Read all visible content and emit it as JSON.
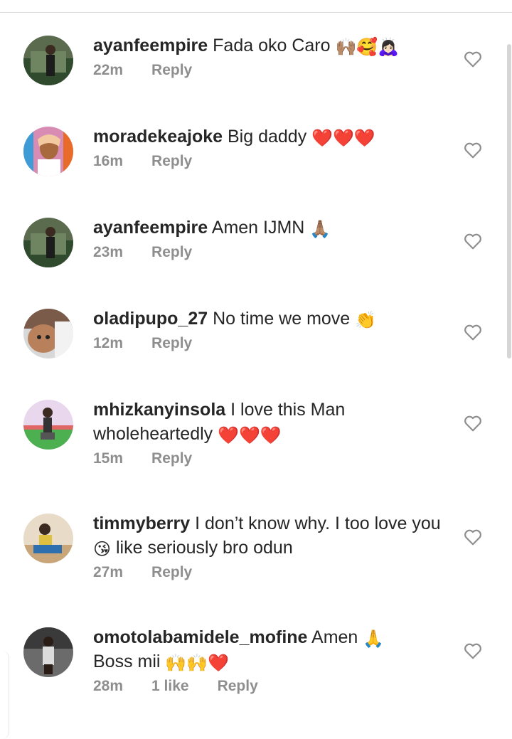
{
  "comments": [
    {
      "username": "ayanfeempire",
      "text": "Fada oko Caro",
      "emoji": "🙌🏽🥰🙇🏻‍♀️",
      "time": "22m",
      "reply": "Reply",
      "avatar_color": "#3f5b3a"
    },
    {
      "username": "moradekeajoke",
      "text": "Big daddy",
      "emoji": "❤️❤️❤️",
      "time": "16m",
      "reply": "Reply",
      "avatar_color": "#b44a78"
    },
    {
      "username": "ayanfeempire",
      "text": "Amen IJMN",
      "emoji": "🙏🏽",
      "time": "23m",
      "reply": "Reply",
      "avatar_color": "#3f5b3a"
    },
    {
      "username": "oladipupo_27",
      "text": "No time we move",
      "emoji": "👏",
      "time": "12m",
      "reply": "Reply",
      "avatar_color": "#7a5a48"
    },
    {
      "username": "mhizkanyinsola",
      "text": "I love this Man wholeheartedly",
      "emoji": "❤️❤️❤️",
      "time": "15m",
      "reply": "Reply",
      "avatar_color": "#6aa84f"
    },
    {
      "username": "timmyberry",
      "text": "I don’t know why. I too love you",
      "emoji": "😘",
      "text_after": "like seriously bro odun",
      "time": "27m",
      "reply": "Reply",
      "avatar_color": "#c9a57a"
    },
    {
      "username": "omotolabamidele_mofine",
      "text": "Amen",
      "emoji": "🙏",
      "text_after": "Boss mii",
      "emoji_after": "🙌🙌❤️",
      "time": "28m",
      "likes": "1 like",
      "reply": "Reply",
      "avatar_color": "#4a4a4a"
    }
  ],
  "colors": {
    "text": "#262626",
    "meta": "#8e8e8e",
    "heart_outline": "#8e8e8e",
    "red": "#e0102a"
  },
  "icons": {
    "like": "heart-outline-icon"
  }
}
